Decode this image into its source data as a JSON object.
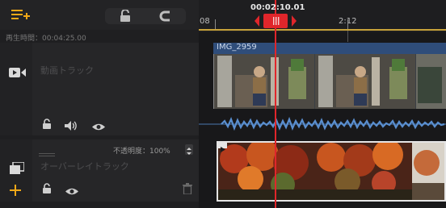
{
  "left_panel": {
    "playback_time": "再生時間：00:04:25.00",
    "video_track": {
      "placeholder": "動画トラック"
    },
    "overlay_track": {
      "placeholder": "オーバーレイトラック",
      "opacity_label": "不透明度：100%"
    }
  },
  "ruler": {
    "left_label": "08",
    "right_label": "2:12",
    "current_time": "00:02:10.01"
  },
  "video_clip": {
    "name": "IMG_2959"
  },
  "icons": {
    "add_media": "add-list-icon",
    "lock": "lock-open-icon",
    "magnet": "magnet-icon",
    "video_camera": "video-camera-icon",
    "volume": "speaker-icon",
    "visibility": "eye-icon",
    "overlay": "overlay-icon",
    "add": "plus-icon",
    "delete": "trash-icon",
    "play_marker": "play-icon"
  },
  "colors": {
    "accent": "#f0a818",
    "playhead": "#e0262b",
    "clip_header": "#2f4d7a",
    "waveform": "#5a8fd0"
  }
}
